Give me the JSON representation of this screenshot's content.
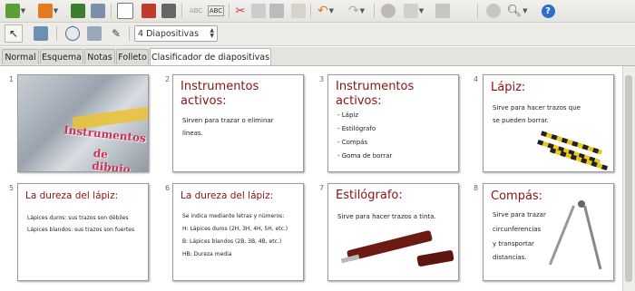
{
  "toolbar": {
    "slides_combo": "4 Diapositivas"
  },
  "tabs": [
    {
      "label": "Normal"
    },
    {
      "label": "Esquema"
    },
    {
      "label": "Notas"
    },
    {
      "label": "Folleto"
    },
    {
      "label": "Clasificador de diapositivas"
    }
  ],
  "slides": [
    {
      "number": "1",
      "title_lines": [
        "Instrumentos",
        "de dibujo"
      ],
      "lines": []
    },
    {
      "number": "2",
      "title_lines": [
        "Instrumentos",
        "activos:"
      ],
      "lines": [
        "Sirven para trazar o eliminar",
        "líneas."
      ]
    },
    {
      "number": "3",
      "title_lines": [
        "Instrumentos",
        "activos:"
      ],
      "lines": [
        "- Lápiz",
        "- Estilógrafo",
        "- Compás",
        "- Goma de borrar"
      ]
    },
    {
      "number": "4",
      "title_lines": [
        "Lápiz:"
      ],
      "lines": [
        "Sirve para hacer trazos que",
        "se pueden borrar."
      ]
    },
    {
      "number": "5",
      "title_lines": [
        "La dureza del lápiz:"
      ],
      "lines": [
        "Lápices duros: sus trazos son débiles",
        "Lápices blandos: sus trazos son fuertes"
      ]
    },
    {
      "number": "6",
      "title_lines": [
        "La dureza del lápiz:"
      ],
      "lines": [
        "Se indica mediante letras y números:",
        "H: Lápices duros (2H, 3H, 4H, 5H, etc.)",
        "B: Lápices blandos (2B, 3B, 4B, etc.)",
        "HB: Dureza media"
      ]
    },
    {
      "number": "7",
      "title_lines": [
        "Estilógrafo:"
      ],
      "lines": [
        "Sirve para hacer trazos a tinta."
      ]
    },
    {
      "number": "8",
      "title_lines": [
        "Compás:"
      ],
      "lines": [
        "Sirve para trazar",
        "circunferencias",
        "y transportar",
        "distancias."
      ]
    }
  ],
  "colors": {
    "title": "#8b1212",
    "slide1_text": "#cc3355"
  }
}
